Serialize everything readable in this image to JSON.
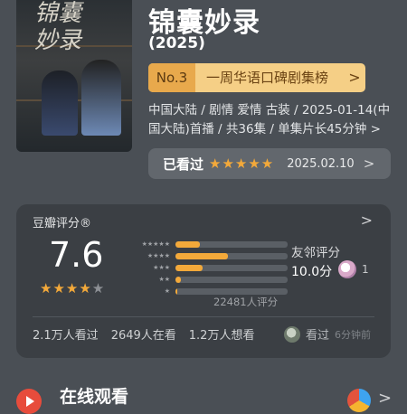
{
  "poster": {
    "calligraphy": "锦囊妙录"
  },
  "title": "锦囊妙录",
  "year": "(2025)",
  "rank": {
    "number": "No.3",
    "label": "一周华语口碑剧集榜",
    "arrow": ">"
  },
  "meta": "中国大陆 / 剧情 爱情 古装 / 2025-01-14(中国大陆)首播 / 共36集 / 单集片长45分钟 >",
  "watched": {
    "label": "已看过",
    "stars": "★★★★★",
    "date": "2025.02.10",
    "arrow": ">"
  },
  "rating": {
    "header": "豆瓣评分®",
    "arrow": ">",
    "score": "7.6",
    "stars_on": "★★★★",
    "stars_off": "★",
    "distribution": [
      {
        "stars": "★★★★★",
        "value": 0.22
      },
      {
        "stars": "★★★★",
        "value": 0.47
      },
      {
        "stars": "★★★",
        "value": 0.24
      },
      {
        "stars": "★★",
        "value": 0.05
      },
      {
        "stars": "★",
        "value": 0.02
      }
    ],
    "count": "22481人评分",
    "friend_label": "友邻评分",
    "friend_score": "10.0分",
    "friend_count": "1",
    "stats": [
      "2.1万人看过",
      "2649人在看",
      "1.2万人想看"
    ],
    "recent_label": "看过",
    "recent_time": "6分钟前"
  },
  "online": {
    "label": "在线观看",
    "arrow": ">"
  },
  "colors": {
    "accent": "#f3a93a",
    "background": "#4a4f55",
    "card": "#3b3f44"
  }
}
